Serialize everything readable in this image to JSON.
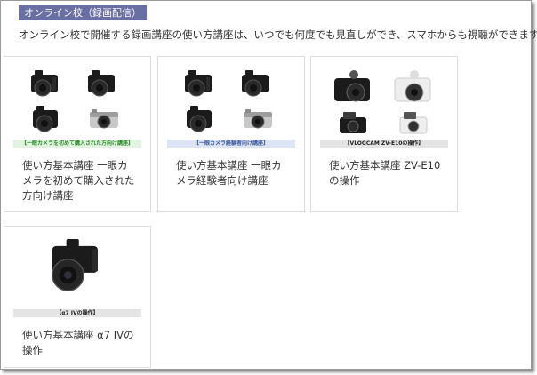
{
  "section": {
    "badge": "オンライン校（録画配信）",
    "intro": "オンライン校で開催する録画講座の使い方講座は、いつでも何度でも見直しができ、スマホからも視聴ができます。"
  },
  "courses": [
    {
      "caption": "【一眼カメラを初めて購入された方向け講座】",
      "title": "使い方基本講座 一眼カメラを初めて購入された方向け講座",
      "caption_bg": "#e2f3df",
      "caption_color": "#2f8a2f"
    },
    {
      "caption": "【一眼カメラ経験者向け講座】",
      "title": "使い方基本講座 一眼カメラ経験者向け講座",
      "caption_bg": "#dde4f3",
      "caption_color": "#3d5a9c"
    },
    {
      "caption": "【VLOGCAM ZV-E10の操作】",
      "title": "使い方基本講座 ZV-E10の操作",
      "caption_bg": "#e4e4e4",
      "caption_color": "#222222"
    },
    {
      "caption": "【α7 IVの操作】",
      "title": "使い方基本講座 α7 IVの操作",
      "caption_bg": "#e4e4e4",
      "caption_color": "#222222"
    }
  ],
  "colors": {
    "badge_bg": "#6a6fa3",
    "card_border": "#dddddd",
    "camera_body": "#1b1b1b",
    "camera_silver": "#c8c8c8"
  }
}
